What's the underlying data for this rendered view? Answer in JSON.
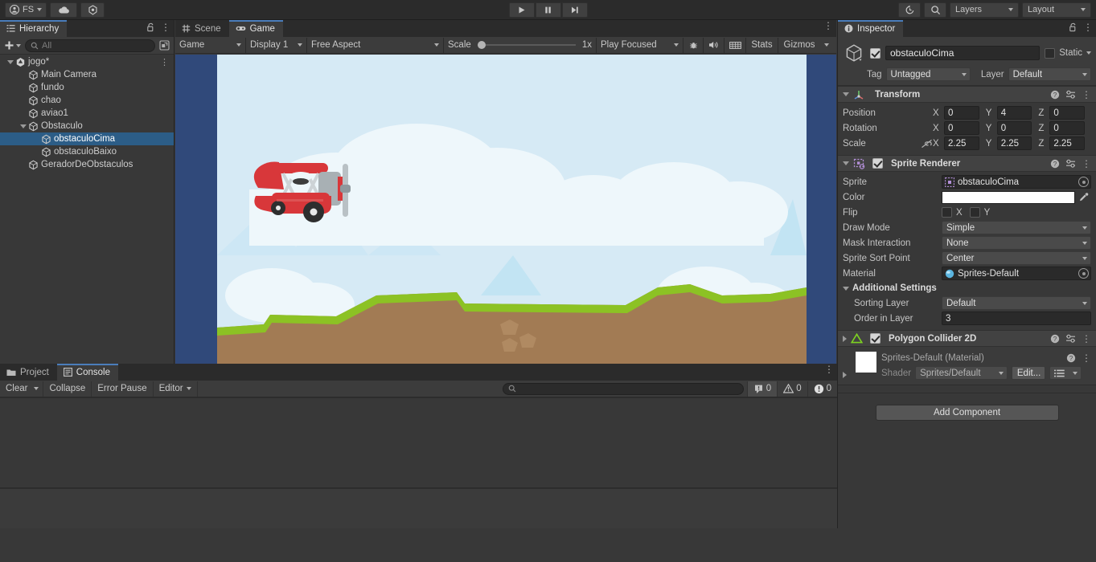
{
  "toolbar": {
    "account_label": "FS",
    "cloud_icon": "cloud-icon",
    "services_icon": "unity-services-icon",
    "play_icon": "play-icon",
    "pause_icon": "pause-icon",
    "step_icon": "step-icon",
    "undo_history_icon": "undo-history-icon",
    "search_icon": "search-icon",
    "layers_label": "Layers",
    "layout_label": "Layout"
  },
  "hierarchy": {
    "tab_label": "Hierarchy",
    "tab_icon": "hierarchy-icon",
    "lock_icon": "lock-icon",
    "menu_icon": "kebab-icon",
    "add_label": "+",
    "search_placeholder": "All",
    "search_icon": "search-icon",
    "sublevel_icon": "sublevel-scene-icon",
    "items": [
      {
        "label": "jogo*",
        "depth": 0,
        "icon": "unity-scene-icon",
        "expanded": true,
        "selected": false,
        "has_menu": true
      },
      {
        "label": "Main Camera",
        "depth": 1,
        "icon": "gameobject-icon",
        "expanded": null,
        "selected": false
      },
      {
        "label": "fundo",
        "depth": 1,
        "icon": "gameobject-icon",
        "expanded": null,
        "selected": false
      },
      {
        "label": "chao",
        "depth": 1,
        "icon": "gameobject-icon",
        "expanded": null,
        "selected": false
      },
      {
        "label": "aviao1",
        "depth": 1,
        "icon": "gameobject-icon",
        "expanded": null,
        "selected": false
      },
      {
        "label": "Obstaculo",
        "depth": 1,
        "icon": "gameobject-icon",
        "expanded": true,
        "selected": false
      },
      {
        "label": "obstaculoCima",
        "depth": 2,
        "icon": "gameobject-icon",
        "expanded": null,
        "selected": true
      },
      {
        "label": "obstaculoBaixo",
        "depth": 2,
        "icon": "gameobject-icon",
        "expanded": null,
        "selected": false
      },
      {
        "label": "GeradorDeObstaculos",
        "depth": 1,
        "icon": "gameobject-icon",
        "expanded": null,
        "selected": false
      }
    ]
  },
  "gameview": {
    "tabs": [
      {
        "label": "Scene",
        "icon": "scene-grid-icon",
        "active": false
      },
      {
        "label": "Game",
        "icon": "gamepad-icon",
        "active": true
      }
    ],
    "menu_icon": "kebab-icon",
    "controls": {
      "view_mode": "Game",
      "display": "Display 1",
      "aspect": "Free Aspect",
      "scale_label": "Scale",
      "scale_value": "1x",
      "play_mode": "Play Focused",
      "mute_icon": "audio-icon",
      "bug_icon": "play-focused-bug-icon",
      "grid_icon": "gizmos-grid-icon",
      "stats_label": "Stats",
      "gizmos_label": "Gizmos"
    },
    "scene": {
      "letterbox_color": "#30497a",
      "sky_color": "#d6eaf5",
      "cloud_color": "#eef7fb",
      "grass_color": "#8cc224",
      "dirt_color": "#a27b54",
      "plane_color": "#d8373a"
    }
  },
  "inspector": {
    "tab_label": "Inspector",
    "tab_icon": "info-icon",
    "lock_icon": "lock-icon",
    "menu_icon": "kebab-icon",
    "object_name": "obstaculoCima",
    "object_enabled": true,
    "static_label": "Static",
    "static_checked": false,
    "tag_label": "Tag",
    "tag_value": "Untagged",
    "layer_label": "Layer",
    "layer_value": "Default",
    "transform": {
      "title": "Transform",
      "icon": "transform-axis-icon",
      "help_icon": "help-icon",
      "preset_icon": "preset-icon",
      "menu_icon": "kebab-icon",
      "rows": [
        {
          "name": "Position",
          "x": "0",
          "y": "4",
          "z": "0",
          "constrain": false
        },
        {
          "name": "Rotation",
          "x": "0",
          "y": "0",
          "z": "0",
          "constrain": false
        },
        {
          "name": "Scale",
          "x": "2.25",
          "y": "2.25",
          "z": "2.25",
          "constrain": true,
          "constrain_icon": "link-off-icon"
        }
      ],
      "axes": [
        "X",
        "Y",
        "Z"
      ]
    },
    "sprite_renderer": {
      "title": "Sprite Renderer",
      "icon": "sprite-renderer-icon",
      "enabled": true,
      "help_icon": "help-icon",
      "preset_icon": "preset-icon",
      "menu_icon": "kebab-icon",
      "sprite_label": "Sprite",
      "sprite_value": "obstaculoCima",
      "sprite_icon": "sprite-asset-icon",
      "color_label": "Color",
      "color_value": "#ffffff",
      "eyedropper_icon": "eyedropper-icon",
      "flip_label": "Flip",
      "flip_x_label": "X",
      "flip_y_label": "Y",
      "flip_x": false,
      "flip_y": false,
      "draw_mode_label": "Draw Mode",
      "draw_mode_value": "Simple",
      "mask_interaction_label": "Mask Interaction",
      "mask_interaction_value": "None",
      "sort_point_label": "Sprite Sort Point",
      "sort_point_value": "Center",
      "material_label": "Material",
      "material_value": "Sprites-Default",
      "material_icon": "material-sphere-icon",
      "additional_settings_label": "Additional Settings",
      "sorting_layer_label": "Sorting Layer",
      "sorting_layer_value": "Default",
      "order_in_layer_label": "Order in Layer",
      "order_in_layer_value": "3"
    },
    "polygon_collider": {
      "title": "Polygon Collider 2D",
      "icon": "polygon-collider-icon",
      "enabled": true,
      "expanded": false,
      "help_icon": "help-icon",
      "preset_icon": "preset-icon",
      "menu_icon": "kebab-icon"
    },
    "material_preview": {
      "title": "Sprites-Default (Material)",
      "shader_label": "Shader",
      "shader_value": "Sprites/Default",
      "edit_label": "Edit...",
      "help_icon": "help-icon",
      "menu_icon": "kebab-icon",
      "list_icon": "list-icon",
      "swatch_color": "#ffffff"
    },
    "add_component_label": "Add Component"
  },
  "console": {
    "tabs": [
      {
        "label": "Project",
        "icon": "folder-icon",
        "active": false
      },
      {
        "label": "Console",
        "icon": "console-icon",
        "active": true
      }
    ],
    "menu_icon": "kebab-icon",
    "clear_label": "Clear",
    "collapse_label": "Collapse",
    "error_pause_label": "Error Pause",
    "editor_label": "Editor",
    "search_placeholder": "",
    "search_icon": "search-icon",
    "counters": [
      {
        "icon": "log-icon",
        "count": "0"
      },
      {
        "icon": "warning-icon",
        "count": "0"
      },
      {
        "icon": "error-icon",
        "count": "0"
      }
    ]
  }
}
